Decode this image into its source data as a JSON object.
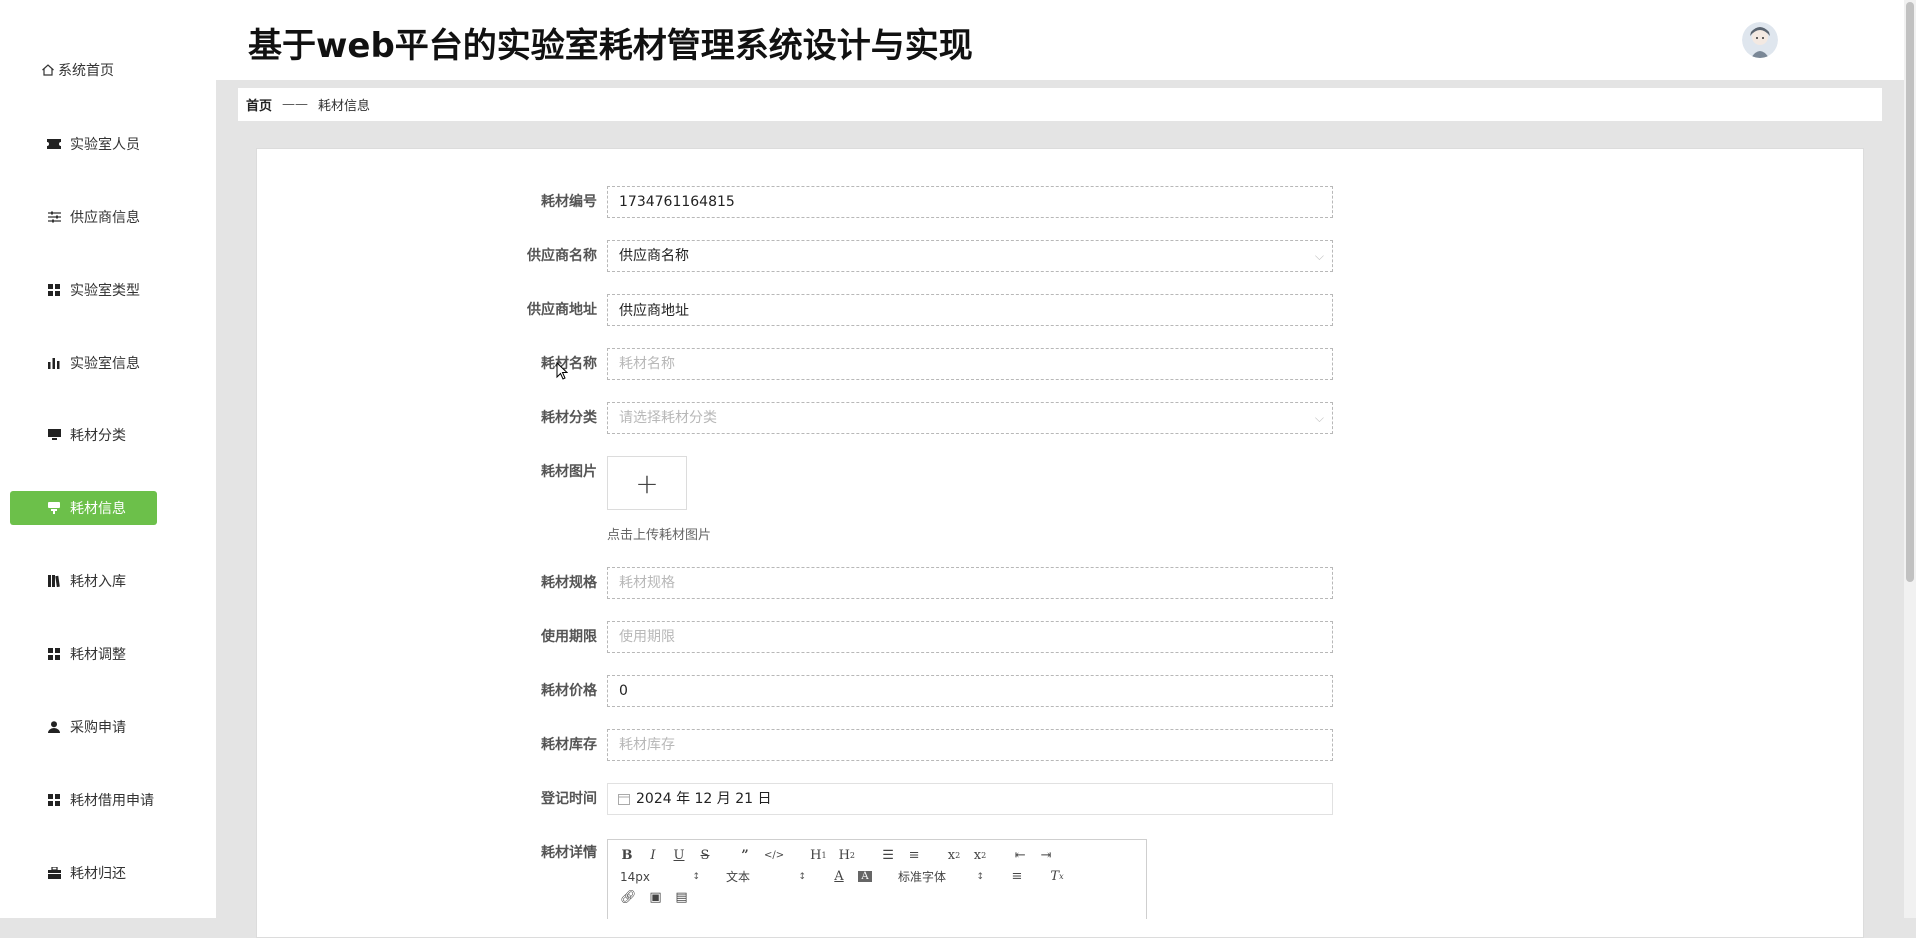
{
  "app": {
    "title": "基于web平台的实验室耗材管理系统设计与实现"
  },
  "sidebar": {
    "items": [
      {
        "label": "系统首页",
        "icon": "home-icon"
      },
      {
        "label": "实验室人员",
        "icon": "ticket-icon"
      },
      {
        "label": "供应商信息",
        "icon": "sliders-icon"
      },
      {
        "label": "实验室类型",
        "icon": "grid-icon"
      },
      {
        "label": "实验室信息",
        "icon": "bar-chart-icon"
      },
      {
        "label": "耗材分类",
        "icon": "monitor-icon"
      },
      {
        "label": "耗材信息",
        "icon": "stamp-icon",
        "active": true
      },
      {
        "label": "耗材入库",
        "icon": "books-icon"
      },
      {
        "label": "耗材调整",
        "icon": "grid-icon"
      },
      {
        "label": "采购申请",
        "icon": "user-icon"
      },
      {
        "label": "耗材借用申请",
        "icon": "grid-icon"
      },
      {
        "label": "耗材归还",
        "icon": "briefcase-icon"
      }
    ],
    "active_color": "#6cc04a"
  },
  "breadcrumb": {
    "home": "首页",
    "separator": "——",
    "current": "耗材信息"
  },
  "form": {
    "code": {
      "label": "耗材编号",
      "value": "1734761164815"
    },
    "supplier_name": {
      "label": "供应商名称",
      "value": "供应商名称"
    },
    "supplier_address": {
      "label": "供应商地址",
      "value": "供应商地址"
    },
    "name": {
      "label": "耗材名称",
      "placeholder": "耗材名称"
    },
    "category": {
      "label": "耗材分类",
      "placeholder": "请选择耗材分类"
    },
    "image": {
      "label": "耗材图片",
      "tip": "点击上传耗材图片",
      "plus": "+"
    },
    "spec": {
      "label": "耗材规格",
      "placeholder": "耗材规格"
    },
    "period": {
      "label": "使用期限",
      "placeholder": "使用期限"
    },
    "price": {
      "label": "耗材价格",
      "value": "0"
    },
    "stock": {
      "label": "耗材库存",
      "placeholder": "耗材库存"
    },
    "date": {
      "label": "登记时间",
      "value": "2024 年 12 月 21 日"
    },
    "detail": {
      "label": "耗材详情"
    }
  },
  "editor": {
    "font_size": "14px",
    "text_type": "文本",
    "font_family": "标准字体"
  }
}
